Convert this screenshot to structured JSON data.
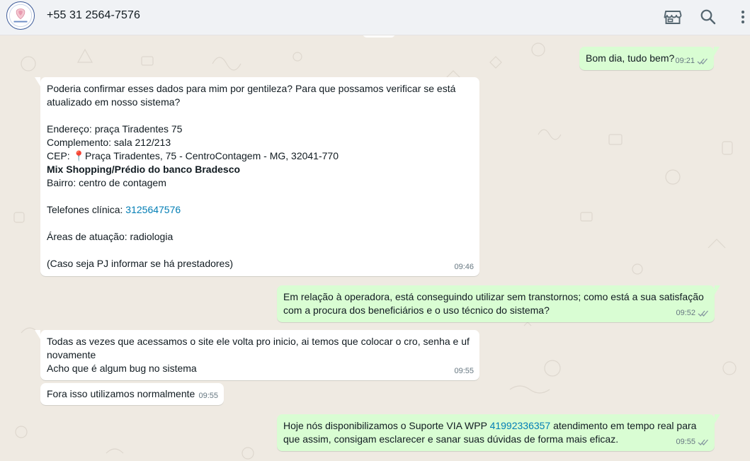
{
  "header": {
    "contact_name": "+55 31 2564-7576",
    "icons": [
      "store-icon",
      "search-icon",
      "menu-icon"
    ]
  },
  "messages": [
    {
      "id": "m1",
      "direction": "outgoing",
      "text": "Bom dia, tudo bem?",
      "time": "09:21",
      "status": "read"
    },
    {
      "id": "m2",
      "direction": "incoming",
      "line1": "Poderia confirmar esses dados para mim por gentileza? Para que possamos verificar se está",
      "line2": "atualizado em nosso sistema?",
      "endereco": "Endereço: praça Tiradentes 75",
      "complemento": "Complemento: sala 212/213",
      "cep_label": "CEP: ",
      "cep_pin": "📍",
      "cep_value": "Praça Tiradentes, 75 - CentroContagem - MG, 32041-770",
      "bold_line": "Mix Shopping/Prédio do banco Bradesco",
      "bairro": "Bairro: centro de contagem",
      "telefones_label": "Telefones clínica: ",
      "telefones_link": "3125647576",
      "areas": "Áreas de atuação: radiologia",
      "pj_note": "(Caso seja PJ informar se há prestadores)",
      "time": "09:46"
    },
    {
      "id": "m3",
      "direction": "outgoing",
      "line1": "Em relação à operadora, está conseguindo utilizar sem transtornos; como está a sua satisfação",
      "line2": "com a procura dos beneficiários e o uso técnico do sistema?",
      "time": "09:52",
      "status": "read"
    },
    {
      "id": "m4",
      "direction": "incoming",
      "line1": "Todas as vezes que acessamos o site ele volta pro inicio, ai temos que colocar o cro, senha e uf",
      "line2": "novamente",
      "line3": "Acho que é algum bug no sistema",
      "time": "09:55"
    },
    {
      "id": "m5",
      "direction": "incoming",
      "text": "Fora isso utilizamos normalmente",
      "time": "09:55"
    },
    {
      "id": "m6",
      "direction": "outgoing",
      "part1": "Hoje nós disponibilizamos o Suporte VIA WPP ",
      "link": "41992336357",
      "part2": " atendimento em tempo real para",
      "line2": "que assim, consigam esclarecer e sanar suas dúvidas de forma mais eficaz.",
      "time": "09:55",
      "status": "read"
    }
  ],
  "colors": {
    "incoming_bubble": "#ffffff",
    "outgoing_bubble": "#d9fdd3",
    "chat_background": "#efeae2",
    "header_background": "#f0f2f5",
    "link": "#027eb5",
    "timestamp": "#667781"
  }
}
